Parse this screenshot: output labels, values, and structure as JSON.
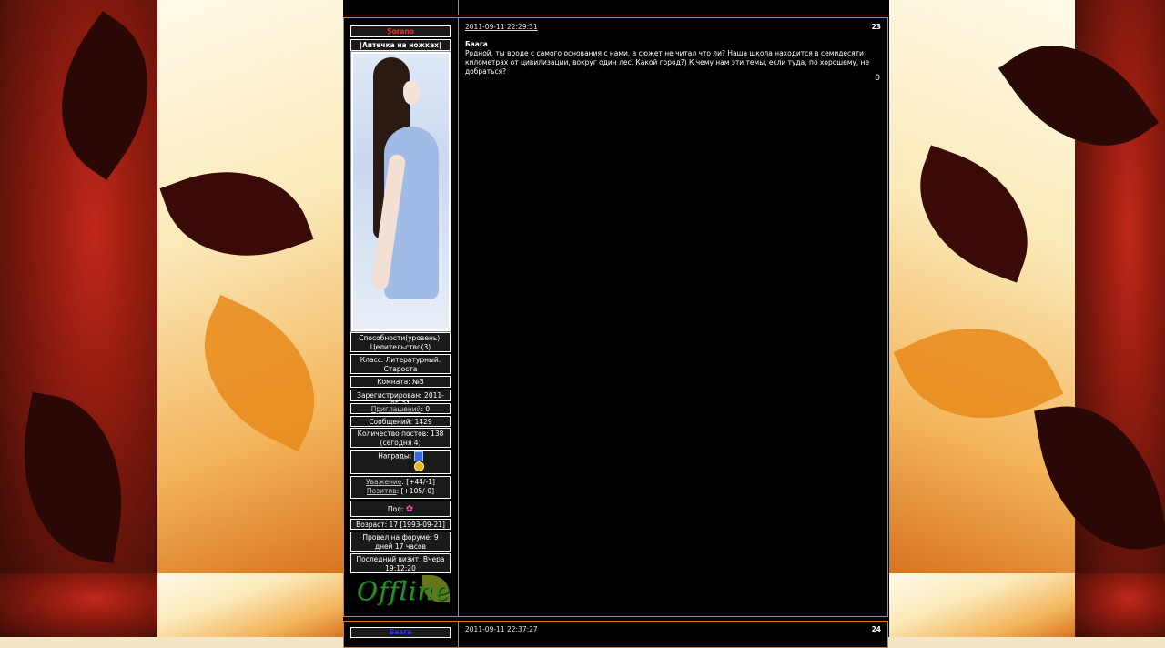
{
  "post1": {
    "author": "Sorano",
    "user_title": "|Аптечка на ножках|",
    "ability": "Способности(уровень): Целительство(3)",
    "class_info": "Класс: Литературный. Староста",
    "room": "Комната: №3",
    "registered": "Зарегистрирован: 2011-05-31",
    "invites_label": "Приглашений",
    "invites_value": ": 0",
    "messages": "Сообщений: 1429",
    "posts_count": "Количество постов: 138 (сегодня 4)",
    "awards_label": "Награды:",
    "respect_label": "Уважение",
    "respect_value": ": [+44/-1]",
    "positive_label": "Позитив",
    "positive_value": ": [+105/-0]",
    "gender_label": "Пол:",
    "age": "Возраст: 17 [1993-09-21]",
    "forum_time": "Провел на форуме: 9 дней 17 часов",
    "last_visit": "Последний визит: Вчера 19:12:20",
    "status": "Offline",
    "date": "2011-09-11 22:29:31",
    "number": "23",
    "addressee": "Баага",
    "message": "Родной, ты вроде с самого основания с нами, а сюжет не читал что ли? Наша школа находится в семидесяти километрах от цивилизации, вокруг один лес. Какой город?) К чему нам эти темы, если туда, по хорошему, не добраться?",
    "rating": "0"
  },
  "post2": {
    "author": "Баага",
    "date": "2011-09-11 22:37:27",
    "number": "24"
  },
  "colors": {
    "border": "#d87c3a",
    "nick_sorano": "#ff2a2a",
    "nick_baaga": "#3030ff",
    "offline": "#2e8b2e"
  }
}
